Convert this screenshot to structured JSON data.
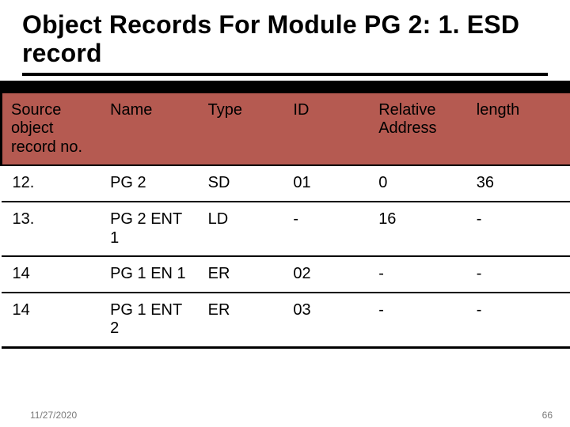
{
  "title": "Object Records For Module PG 2: 1. ESD record",
  "table": {
    "headers": [
      "Source object record no.",
      "Name",
      "Type",
      "ID",
      "Relative Address",
      "length"
    ],
    "rows": [
      [
        "12.",
        "PG 2",
        "SD",
        "01",
        "0",
        "36"
      ],
      [
        "13.",
        "PG 2 ENT 1",
        "LD",
        "-",
        "16",
        "-"
      ],
      [
        "14",
        "PG 1 EN 1",
        "ER",
        "02",
        "-",
        "-"
      ],
      [
        "14",
        "PG 1 ENT 2",
        "ER",
        "03",
        "-",
        "-"
      ]
    ]
  },
  "footer": {
    "date": "11/27/2020",
    "page": "66"
  }
}
